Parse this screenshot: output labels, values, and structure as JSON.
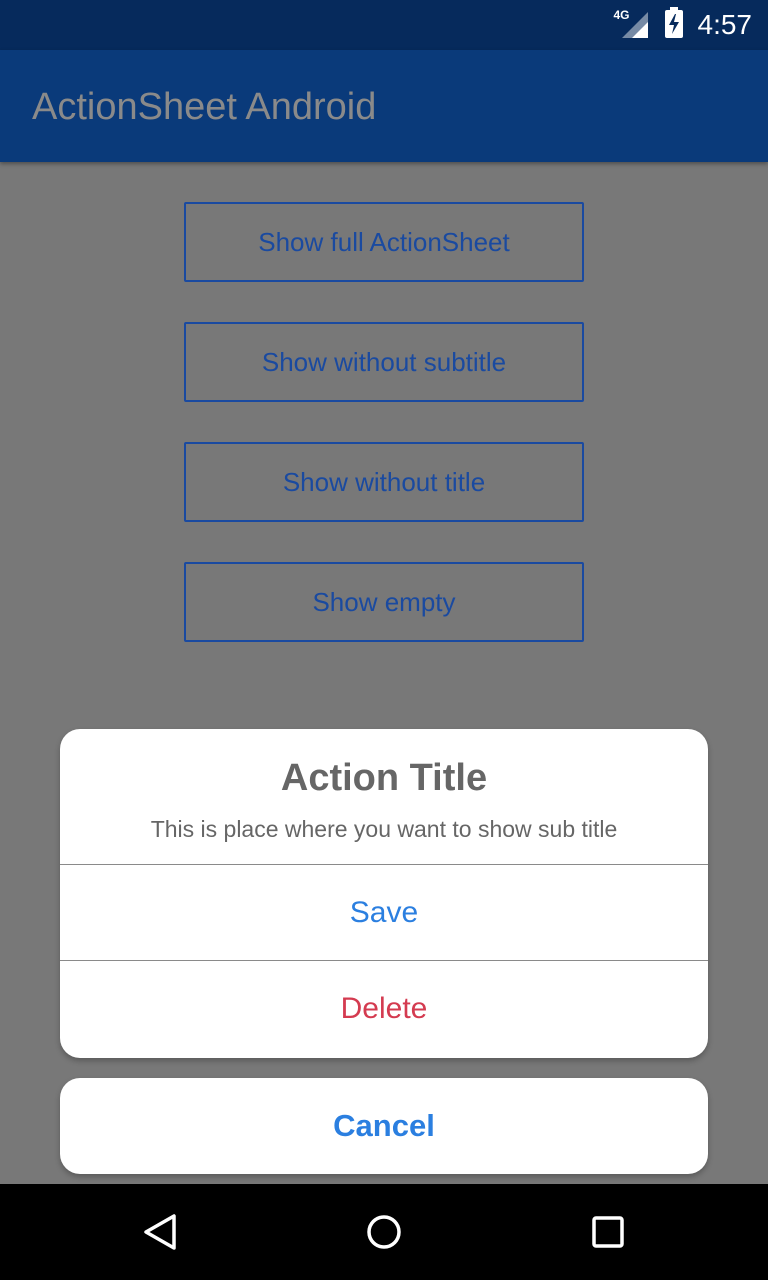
{
  "status_bar": {
    "network_label": "4G",
    "time": "4:57",
    "icons": [
      "signal-icon",
      "battery-charging-icon"
    ]
  },
  "app_bar": {
    "title": "ActionSheet Android"
  },
  "buttons": [
    {
      "label": "Show full ActionSheet"
    },
    {
      "label": "Show without subtitle"
    },
    {
      "label": "Show without title"
    },
    {
      "label": "Show empty"
    }
  ],
  "action_sheet": {
    "title": "Action Title",
    "subtitle": "This is place where you want to show sub title",
    "items": [
      {
        "label": "Save",
        "color": "#2b7fe0"
      },
      {
        "label": "Delete",
        "color": "#d43b50"
      }
    ],
    "cancel_label": "Cancel"
  },
  "nav_bar": {
    "icons": [
      "back-icon",
      "home-icon",
      "recents-icon"
    ]
  },
  "colors": {
    "status_bar": "#062a5c",
    "app_bar": "#0a3a7a",
    "scrim_background": "#787878",
    "button_accent": "#1a4aa0",
    "action_blue": "#2b7fe0",
    "destructive_red": "#d43b50"
  }
}
